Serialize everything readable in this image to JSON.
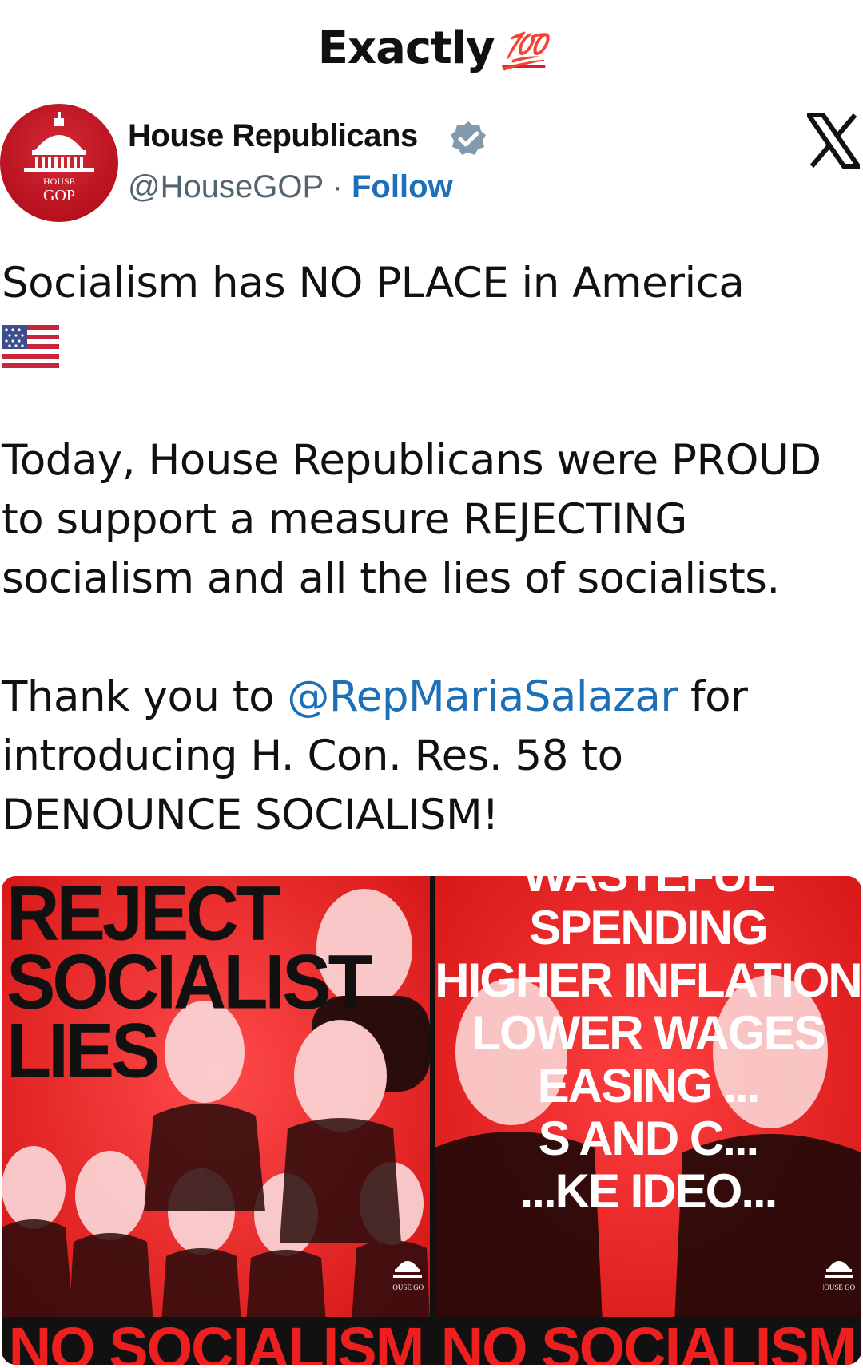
{
  "caption": {
    "text": "Exactly",
    "emoji": "💯"
  },
  "author": {
    "avatar_text_top": "HOUSE",
    "avatar_text_bottom": "GOP",
    "display_name": "House Republicans",
    "handle": "@HouseGOP",
    "separator": "·",
    "follow_label": "Follow"
  },
  "tweet": {
    "line1": "Socialism has NO PLACE in America",
    "para2": "Today, House Republicans were PROUD to support a measure REJECTING socialism and all the lies of socialists.",
    "para3_prefix": "Thank you to ",
    "para3_mention": "@RepMariaSalazar",
    "para3_suffix": " for introducing H. Con. Res. 58 to DENOUNCE SOCIALISM!"
  },
  "media": {
    "left": {
      "title_lines": [
        "REJECT",
        "SOCIALIST",
        "LIES"
      ],
      "banner": "NO SOCIALISM",
      "logo_text": "HOUSE GOP"
    },
    "right": {
      "lines": [
        "WASTEFUL SPENDING",
        "HIGHER INFLATION",
        "LOWER WAGES",
        "EASING ...",
        "S AND C...",
        "...KE IDEO..."
      ],
      "banner": "NO SOCIALISM",
      "logo_text": "HOUSE GOP"
    }
  },
  "colors": {
    "accent_link": "#1d6fb8",
    "gop_red": "#b8121e",
    "poster_red": "#e81d1d"
  }
}
